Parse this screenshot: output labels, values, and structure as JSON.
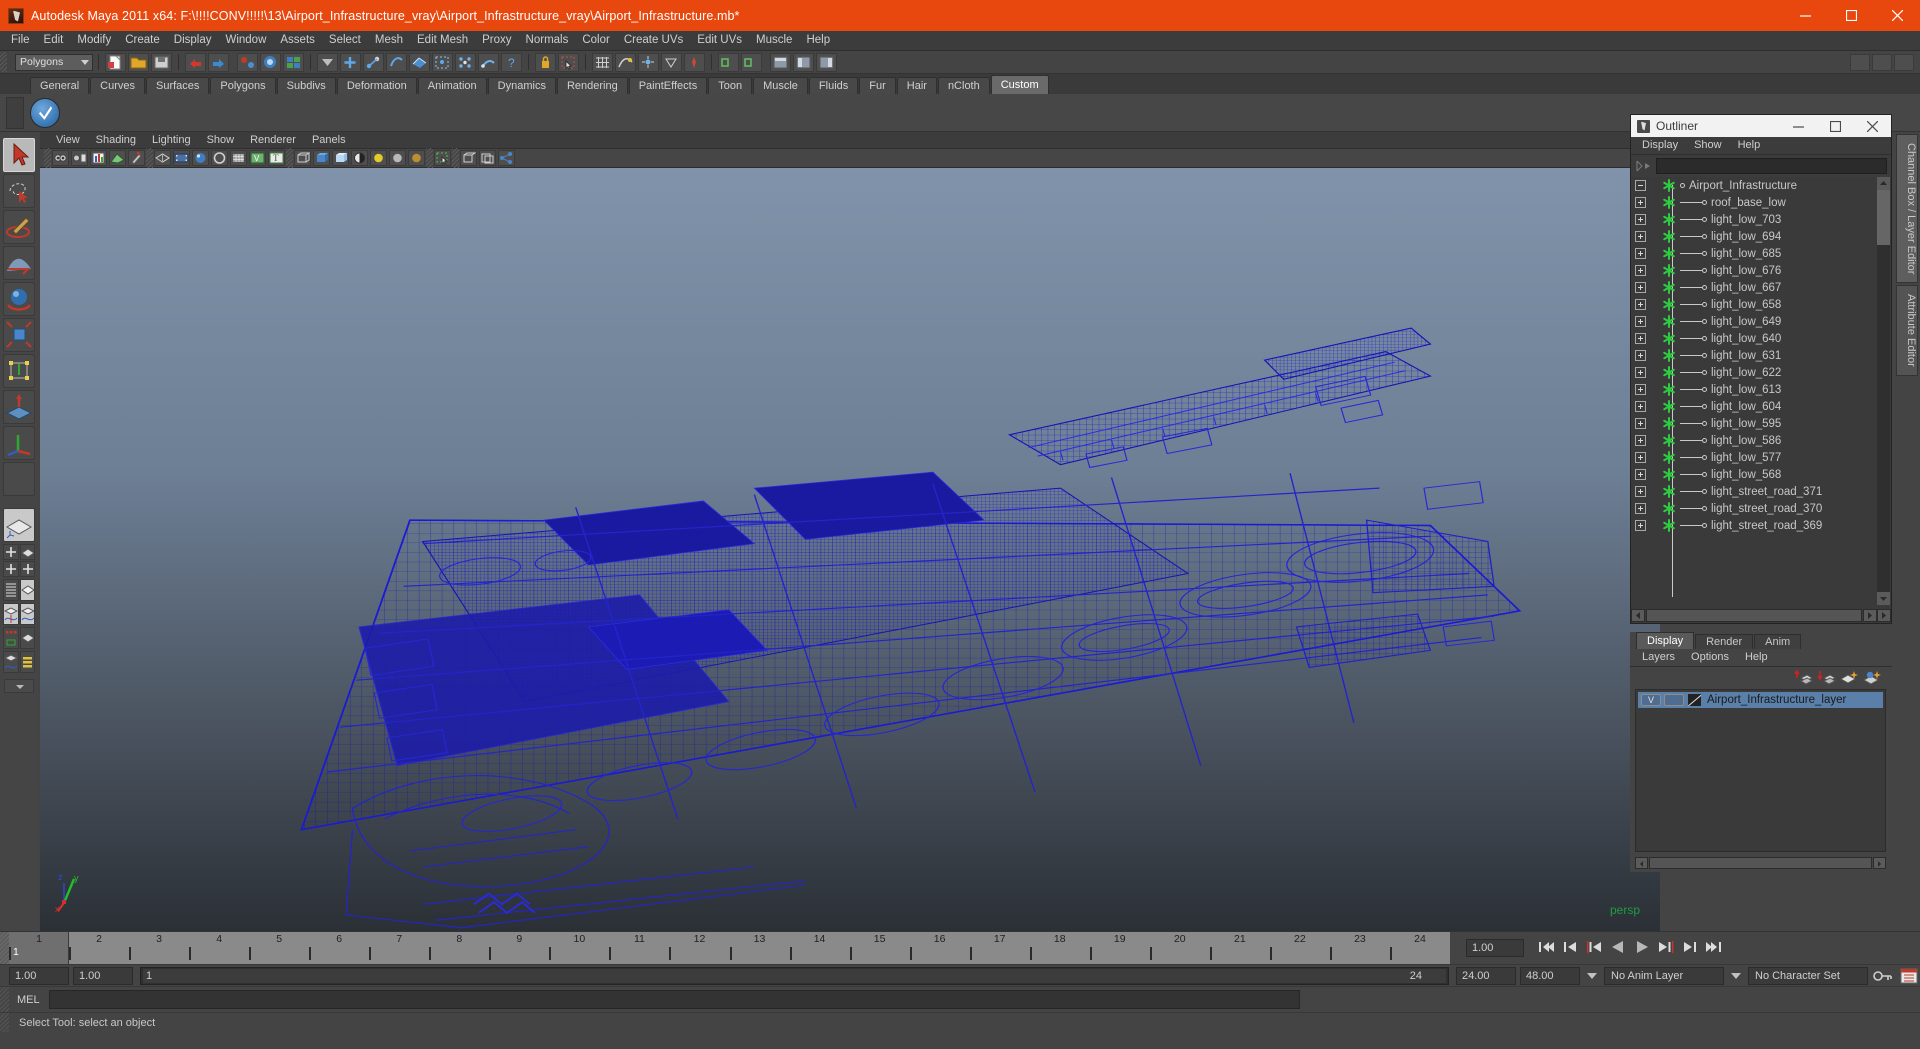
{
  "window": {
    "title": "Autodesk Maya 2011 x64: F:\\!!!!CONV!!!!!\\13\\Airport_Infrastructure_vray\\Airport_Infrastructure_vray\\Airport_Infrastructure.mb*",
    "minimize": "minimize-icon",
    "maximize": "maximize-icon",
    "close": "close-icon",
    "title_bg": "#e8470e"
  },
  "menubar": {
    "items": [
      "File",
      "Edit",
      "Modify",
      "Create",
      "Display",
      "Window",
      "Assets",
      "Select",
      "Mesh",
      "Edit Mesh",
      "Proxy",
      "Normals",
      "Color",
      "Create UVs",
      "Edit UVs",
      "Muscle",
      "Help"
    ]
  },
  "statusline": {
    "mode": "Polygons"
  },
  "shelf": {
    "tabs": [
      "General",
      "Curves",
      "Surfaces",
      "Polygons",
      "Subdivs",
      "Deformation",
      "Animation",
      "Dynamics",
      "Rendering",
      "PaintEffects",
      "Toon",
      "Muscle",
      "Fluids",
      "Fur",
      "Hair",
      "nCloth",
      "Custom"
    ],
    "active_tab": "Custom"
  },
  "viewport": {
    "menus": [
      "View",
      "Shading",
      "Lighting",
      "Show",
      "Renderer",
      "Panels"
    ],
    "camera_label": "persp",
    "camera_label_color": "#1f9c41",
    "axis": {
      "x": "x",
      "y": "y",
      "z": "z"
    },
    "wireframe_color": "#1414b4"
  },
  "outliner": {
    "title": "Outliner",
    "menus": [
      "Display",
      "Show",
      "Help"
    ],
    "search_value": "",
    "items": [
      {
        "label": "Airport_Infrastructure",
        "expander": "minus",
        "root": true
      },
      {
        "label": "roof_base_low",
        "expander": "plus",
        "root": false
      },
      {
        "label": "light_low_703",
        "expander": "plus",
        "root": false
      },
      {
        "label": "light_low_694",
        "expander": "plus",
        "root": false
      },
      {
        "label": "light_low_685",
        "expander": "plus",
        "root": false
      },
      {
        "label": "light_low_676",
        "expander": "plus",
        "root": false
      },
      {
        "label": "light_low_667",
        "expander": "plus",
        "root": false
      },
      {
        "label": "light_low_658",
        "expander": "plus",
        "root": false
      },
      {
        "label": "light_low_649",
        "expander": "plus",
        "root": false
      },
      {
        "label": "light_low_640",
        "expander": "plus",
        "root": false
      },
      {
        "label": "light_low_631",
        "expander": "plus",
        "root": false
      },
      {
        "label": "light_low_622",
        "expander": "plus",
        "root": false
      },
      {
        "label": "light_low_613",
        "expander": "plus",
        "root": false
      },
      {
        "label": "light_low_604",
        "expander": "plus",
        "root": false
      },
      {
        "label": "light_low_595",
        "expander": "plus",
        "root": false
      },
      {
        "label": "light_low_586",
        "expander": "plus",
        "root": false
      },
      {
        "label": "light_low_577",
        "expander": "plus",
        "root": false
      },
      {
        "label": "light_low_568",
        "expander": "plus",
        "root": false
      },
      {
        "label": "light_street_road_371",
        "expander": "plus",
        "root": false
      },
      {
        "label": "light_street_road_370",
        "expander": "plus",
        "root": false
      },
      {
        "label": "light_street_road_369",
        "expander": "plus",
        "root": false
      }
    ]
  },
  "layer_editor": {
    "tabs": [
      "Display",
      "Render",
      "Anim"
    ],
    "active_tab": "Display",
    "menus": [
      "Layers",
      "Options",
      "Help"
    ],
    "toolbar_icons": [
      "move-layer-up-icon",
      "move-layer-down-icon",
      "new-layer-icon",
      "new-layer-from-selected-icon"
    ],
    "layers": [
      {
        "visibility": "V",
        "playback": "",
        "name": "Airport_Infrastructure_layer",
        "selected": true
      }
    ]
  },
  "right_tabs": [
    {
      "label": "Channel Box / Layer Editor",
      "active": true
    },
    {
      "label": "Attribute Editor",
      "active": false
    }
  ],
  "timeline": {
    "ticks": [
      1,
      2,
      3,
      4,
      5,
      6,
      7,
      8,
      9,
      10,
      11,
      12,
      13,
      14,
      15,
      16,
      17,
      18,
      19,
      20,
      21,
      22,
      23,
      24
    ],
    "current_frame": "1",
    "playback_speed": "1.00",
    "transport": [
      "go-to-start-icon",
      "step-back-frame-icon",
      "step-back-key-icon",
      "play-backwards-icon",
      "play-forwards-icon",
      "step-forward-key-icon",
      "step-forward-frame-icon",
      "go-to-end-icon"
    ]
  },
  "range": {
    "start": "1.00",
    "end": "1.00",
    "range_start_label": "1",
    "range_end_label": "24",
    "anim_start": "24.00",
    "anim_end": "48.00",
    "anim_layer": "No Anim Layer",
    "character_set": "No Character Set",
    "key_icon": "key-icon",
    "anim_prefs_icon": "animation-preferences-icon"
  },
  "command_line": {
    "label": "MEL",
    "value": ""
  },
  "help_line": {
    "text": "Select Tool: select an object"
  },
  "toolbox": {
    "tools": [
      "select-tool",
      "lasso-select-tool",
      "paint-select-tool",
      "soft-modification-tool",
      "rotate-tool",
      "scale-tool",
      "universal-manipulator-tool",
      "show-manipulator-tool",
      "move-tool",
      "blank-tool"
    ],
    "layouts": [
      "single-perspective-layout",
      "four-view-layout",
      "outliner-persp-layout",
      "persp-graph-layout",
      "hypershade-persp-layout",
      "persp-graph-outliner-layout"
    ]
  }
}
